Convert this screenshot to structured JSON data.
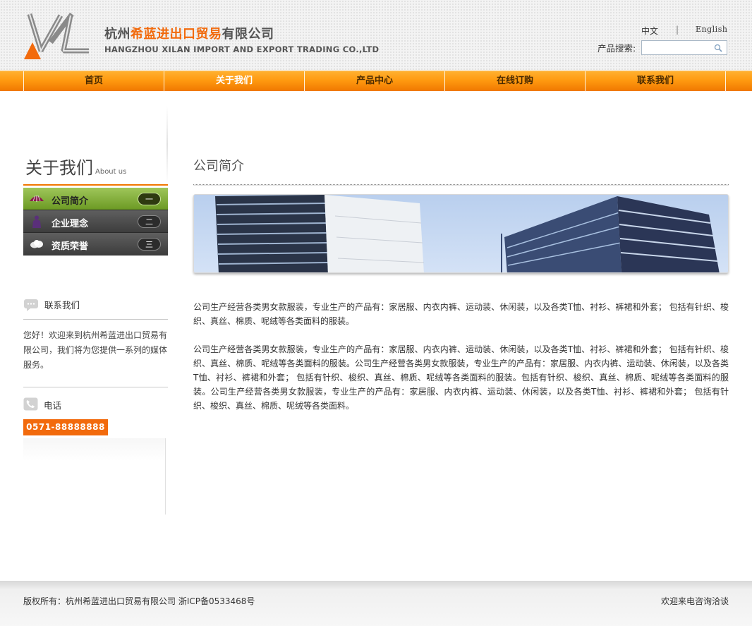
{
  "header": {
    "logo_alt": "XL",
    "company_cn_part1": "杭州",
    "company_cn_highlight": "希蓝进出口贸易",
    "company_cn_part2": "有限公司",
    "company_en": "HANGZHOU XILAN IMPORT AND EXPORT TRADING CO.,LTD",
    "lang_cn": "中文",
    "lang_sep": "|",
    "lang_en": "English",
    "search_label": "产品搜索:",
    "search_value": "",
    "search_icon": "magnifier-icon"
  },
  "nav": {
    "items": [
      {
        "label": "首页",
        "active": false
      },
      {
        "label": "关于我们",
        "active": true
      },
      {
        "label": "产品中心",
        "active": false
      },
      {
        "label": "在线订购",
        "active": false
      },
      {
        "label": "联系我们",
        "active": false
      }
    ]
  },
  "sidebar": {
    "title": "关于我们",
    "title_en": "About us",
    "items": [
      {
        "label": "公司简介",
        "num": "一",
        "icon": "umbrella-icon",
        "active": true
      },
      {
        "label": "企业理念",
        "num": "二",
        "icon": "person-icon",
        "active": false
      },
      {
        "label": "资质荣誉",
        "num": "三",
        "icon": "cloud-icon",
        "active": false
      }
    ],
    "contact_title": "联系我们",
    "welcome": "您好！欢迎来到杭州希蓝进出口贸易有限公司，我们将为您提供一系列的媒体服务。",
    "phone_title": "电话",
    "phone_number": "0571-88888888"
  },
  "main": {
    "title": "公司简介",
    "paragraph1": "公司生产经营各类男女款服装，专业生产的产品有：家居服、内衣内裤、运动装、休闲装，以及各类T恤、衬衫、裤裙和外套； 包括有针织、梭织、真丝、棉质、呢绒等各类面料的服装。",
    "paragraph2": "公司生产经营各类男女款服装，专业生产的产品有：家居服、内衣内裤、运动装、休闲装，以及各类T恤、衬衫、裤裙和外套； 包括有针织、梭织、真丝、棉质、呢绒等各类面料的服装。公司生产经营各类男女款服装，专业生产的产品有：家居服、内衣内裤、运动装、休闲装，以及各类T恤、衬衫、裤裙和外套； 包括有针织、梭织、真丝、棉质、呢绒等各类面料的服装。包括有针织、梭织、真丝、棉质、呢绒等各类面料的服装。公司生产经营各类男女款服装，专业生产的产品有：家居服、内衣内裤、运动装、休闲装，以及各类T恤、衬衫、裤裙和外套； 包括有针织、梭织、真丝、棉质、呢绒等各类面料。"
  },
  "footer": {
    "copyright": "版权所有：杭州希蓝进出口贸易有限公司 浙ICP备0533468号",
    "right_text": "欢迎来电咨询洽谈"
  },
  "colors": {
    "accent_orange": "#f26a0c",
    "active_green": "#7ca832",
    "menu_dark": "#4a4a4a"
  }
}
